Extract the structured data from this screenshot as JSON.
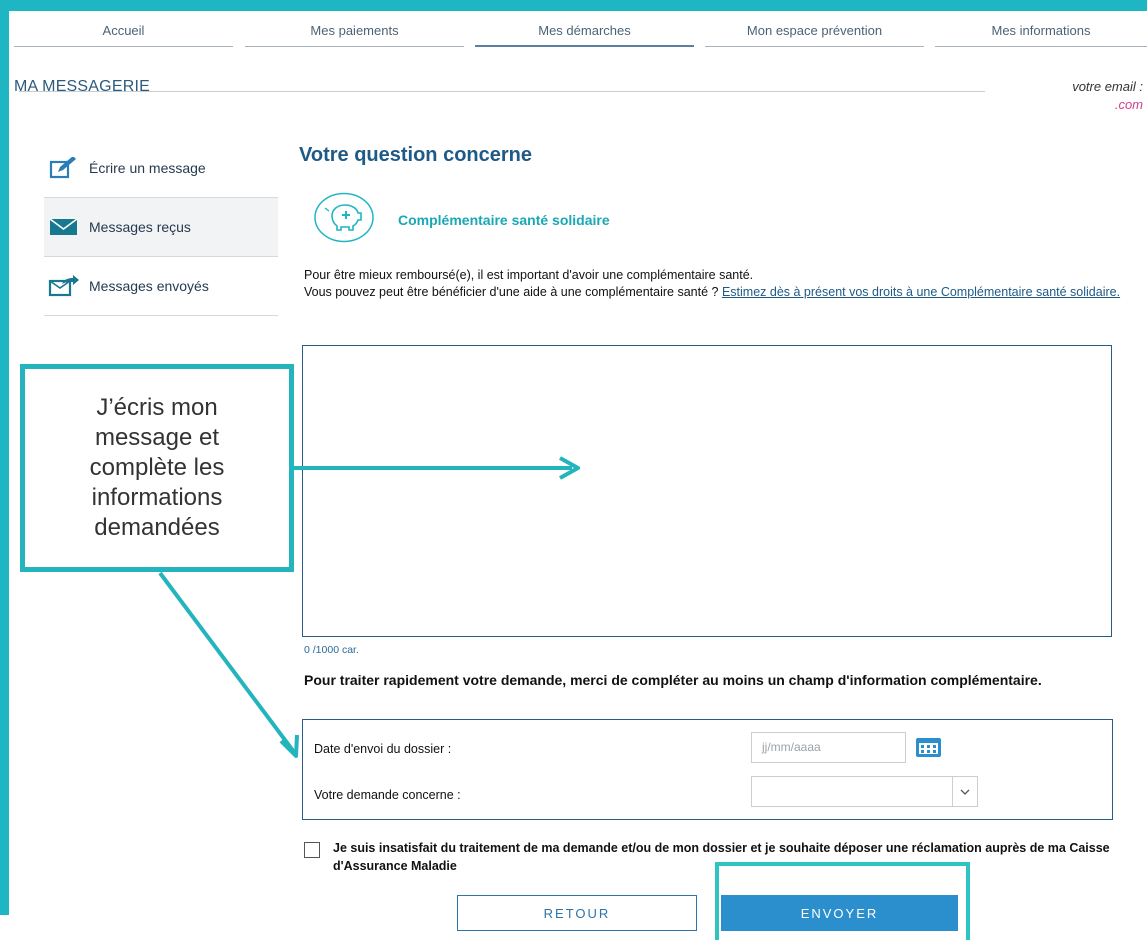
{
  "nav": {
    "tabs": [
      {
        "label": "Accueil"
      },
      {
        "label": "Mes paiements"
      },
      {
        "label": "Mes démarches"
      },
      {
        "label": "Mon espace prévention"
      },
      {
        "label": "Mes informations"
      }
    ],
    "active_tab": "Mes démarches"
  },
  "header": {
    "title": "MA MESSAGERIE",
    "email_label": "votre email :",
    "email_value": ".com"
  },
  "sidebar": {
    "items": [
      {
        "label": "Écrire un message",
        "icon": "pencil-icon"
      },
      {
        "label": "Messages reçus",
        "icon": "envelope-icon"
      },
      {
        "label": "Messages envoyés",
        "icon": "sent-message-icon"
      }
    ]
  },
  "main": {
    "heading": "Votre question concerne",
    "topic": {
      "label": "Complémentaire santé solidaire",
      "icon": "piggy-bank-icon"
    },
    "info_line1": "Pour être mieux remboursé(e), il est important d'avoir une complémentaire santé.",
    "info_line2": "Vous pouvez peut être bénéficier d'une aide à une complémentaire santé ? ",
    "info_link": "Estimez dès à présent vos droits à une Complémentaire santé solidaire.",
    "message_value": "",
    "char_count": "0 /1000 car.",
    "instruction": "Pour traiter rapidement votre demande, merci de compléter au moins un champ d'information complémentaire.",
    "fields": {
      "date_label": "Date d'envoi du dossier :",
      "date_placeholder": "jj/mm/aaaa",
      "concern_label": "Votre demande concerne :",
      "concern_value": ""
    },
    "complaint_label": "Je suis insatisfait du traitement de ma demande et/ou de mon dossier et je souhaite déposer une réclamation auprès de ma Caisse d'Assurance Maladie",
    "buttons": {
      "back": "RETOUR",
      "send": "ENVOYER"
    }
  },
  "callout": {
    "text": "J’écris mon message et complète les informations demandées"
  },
  "colors": {
    "accent": "#1fb6c3",
    "primary_blue": "#1e5a86",
    "button_blue": "#2b8fcd",
    "email_pink": "#d1408e"
  }
}
